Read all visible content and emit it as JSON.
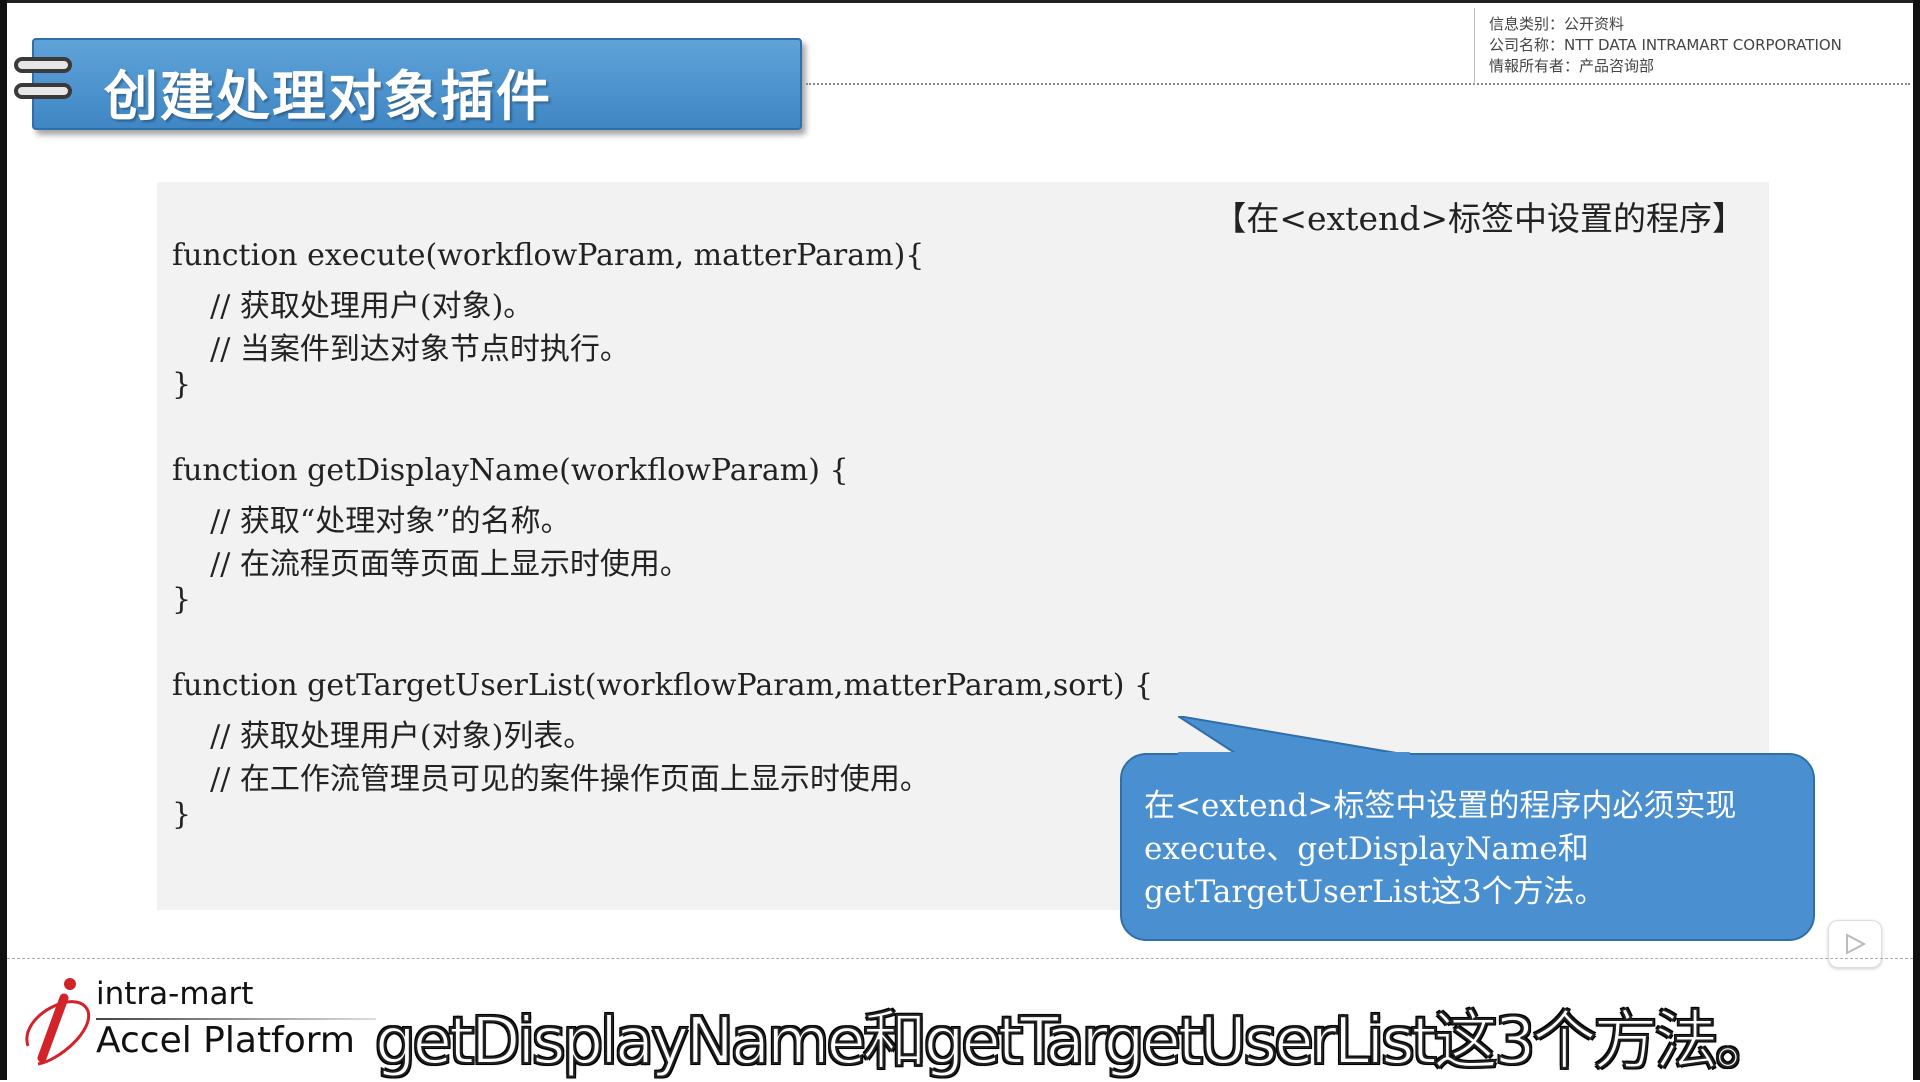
{
  "slide": {
    "title": "创建处理对象插件"
  },
  "info": {
    "line1": "信息类别：公开资料",
    "line2": "公司名称：NTT DATA INTRAMART CORPORATION",
    "line3": "情報所有者：产品咨询部"
  },
  "code": {
    "caption": "【在<extend>标签中设置的程序】",
    "lines": [
      "function execute(workflowParam, matterParam){",
      "    // 获取处理用户(对象)。",
      "    // 当案件到达对象节点时执行。",
      "}",
      "",
      "function getDisplayName(workflowParam) {",
      "    // 获取“处理对象”的名称。",
      "    // 在流程页面等页面上显示时使用。",
      "}",
      "",
      "function getTargetUserList(workflowParam,matterParam,sort) {",
      "    // 获取处理用户(对象)列表。",
      "    // 在工作流管理员可见的案件操作页面上显示时使用。",
      "}"
    ]
  },
  "callout": {
    "line1": "在<extend>标签中设置的程序内必须实现",
    "line2": "execute、getDisplayName和",
    "line3": "getTargetUserList这3个方法。"
  },
  "logo": {
    "line1": "intra-mart",
    "line2": "Accel Platform"
  },
  "subtitle": {
    "text": "getDisplayName和getTargetUserList这3个方法。"
  },
  "colors": {
    "banner": "#4a90d0",
    "code_bg": "#f2f2f2",
    "logo_red": "#d2232a"
  }
}
